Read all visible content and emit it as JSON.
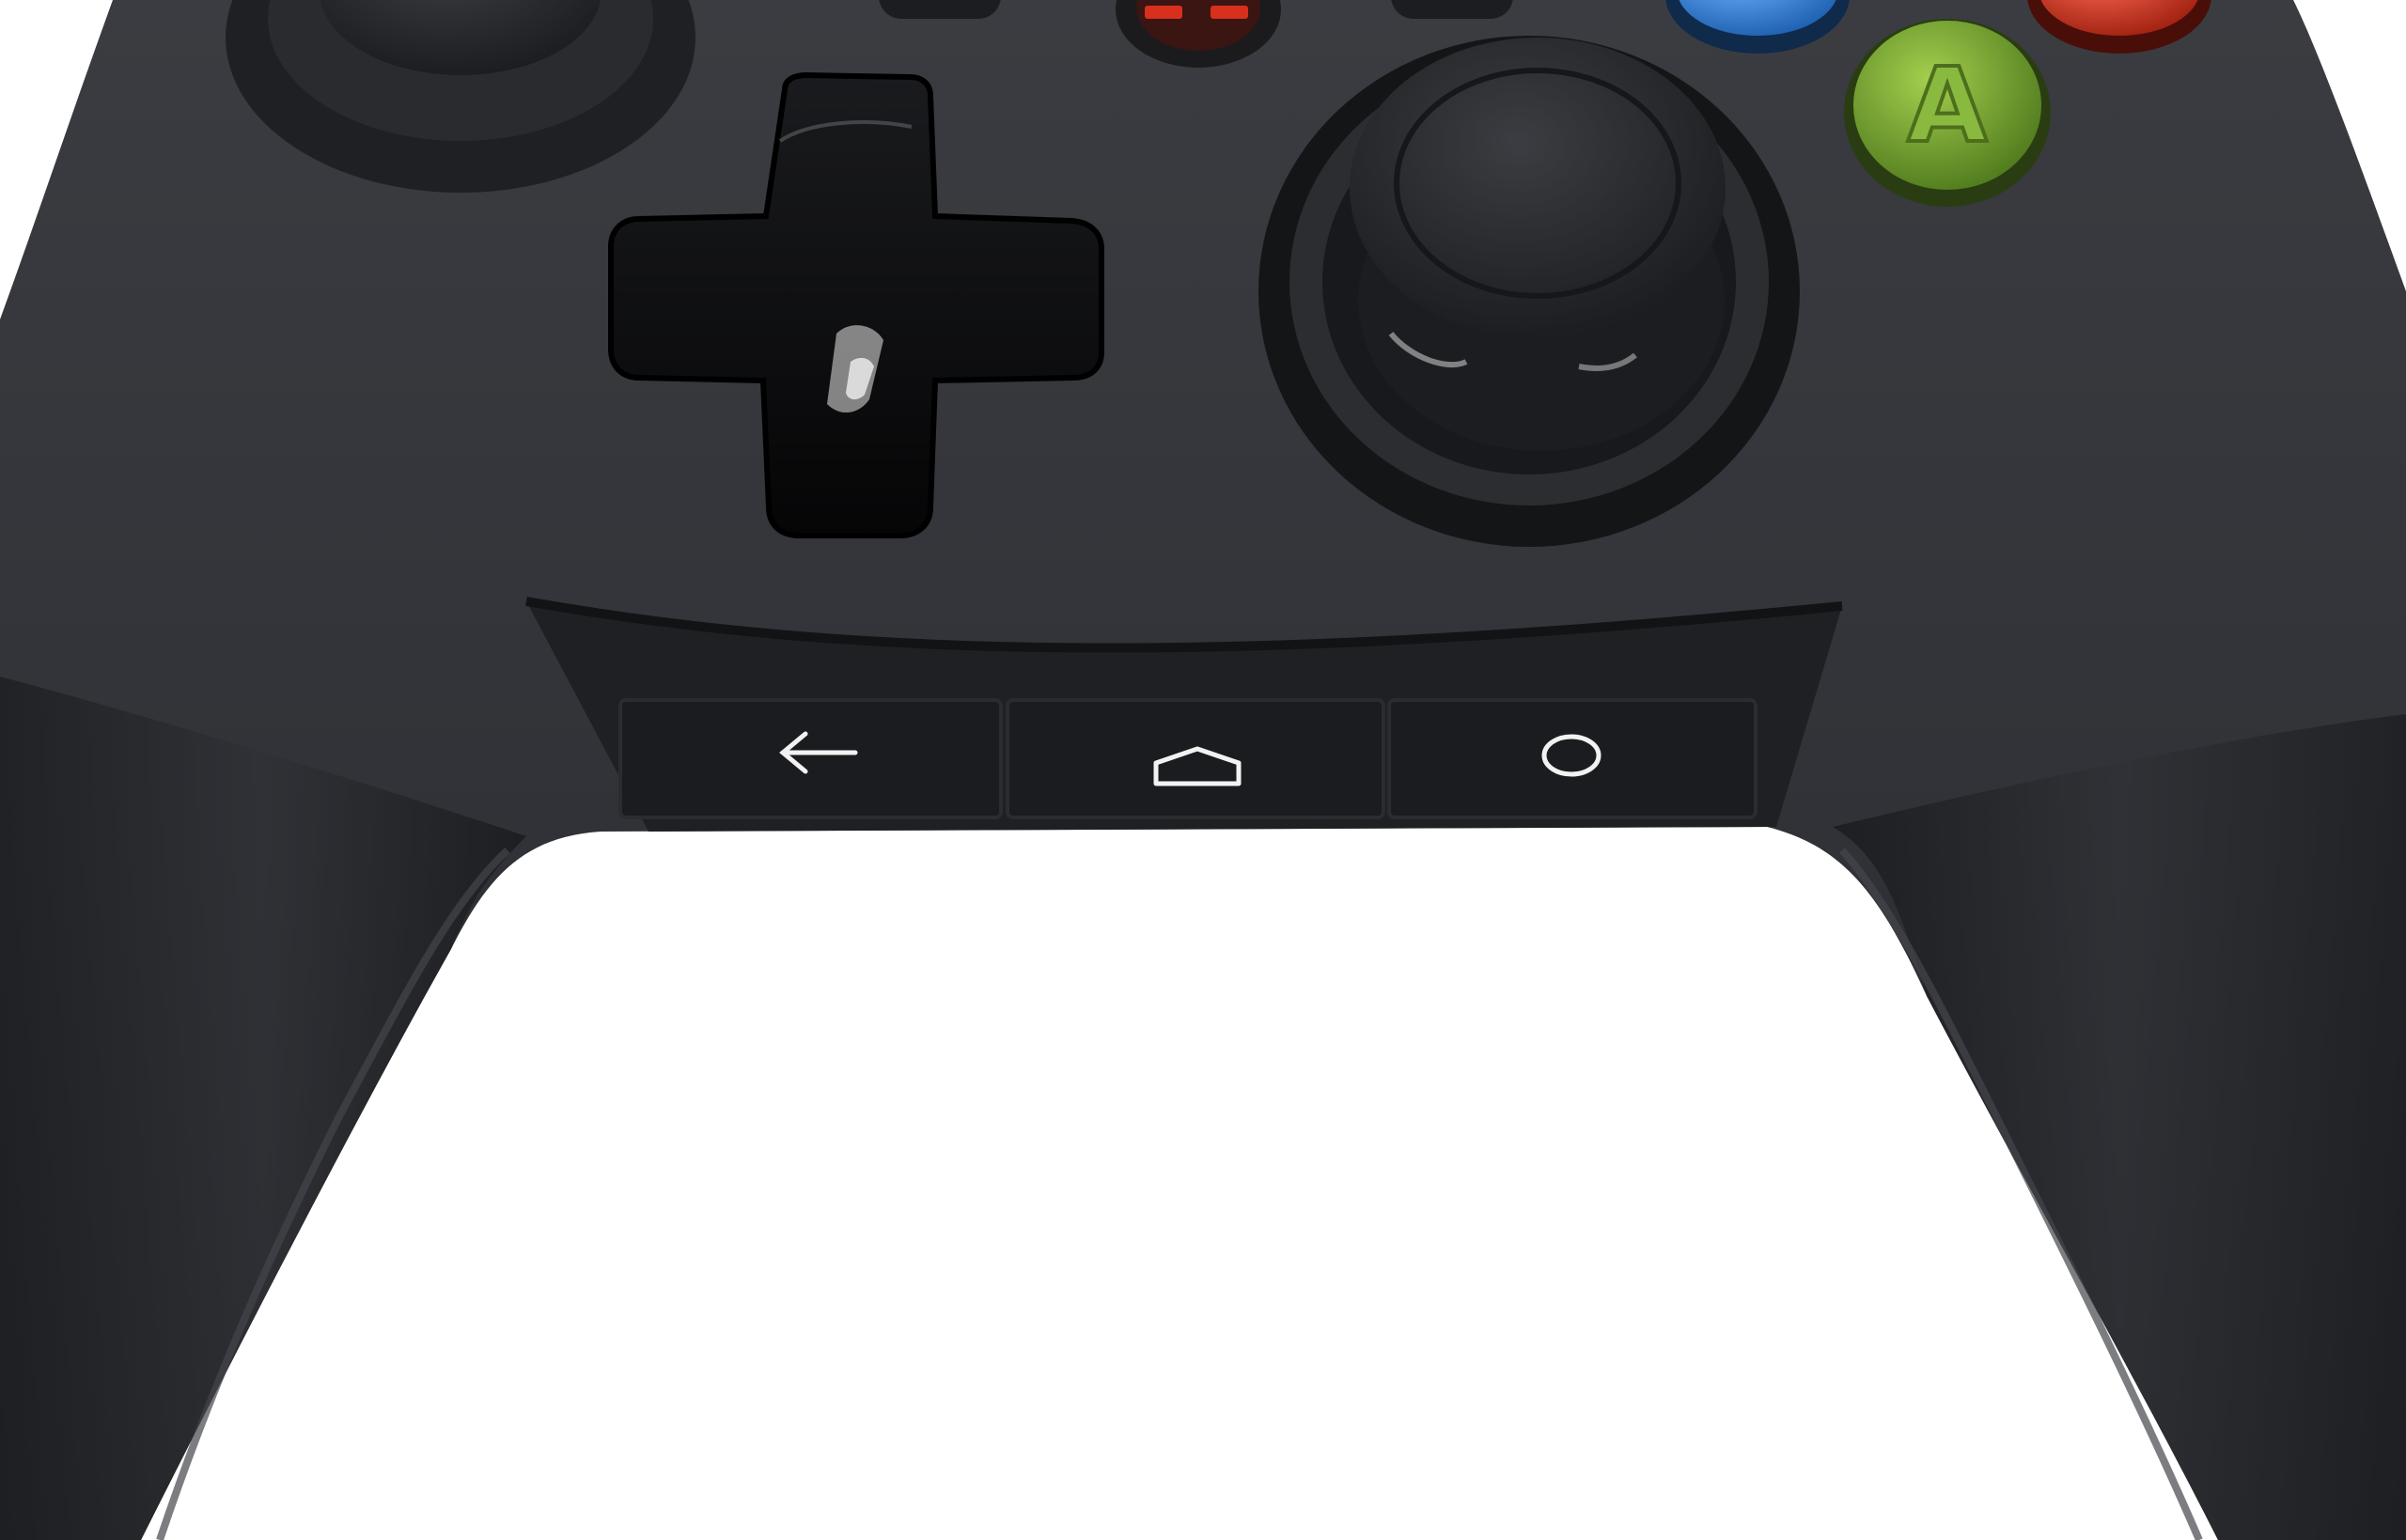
{
  "controller": {
    "colors": {
      "body": "#34363b",
      "body_shadow": "#1c1d20",
      "nav_panel": "#1e1f22",
      "dpad": "#0d0e10",
      "stick": "#1f2023",
      "button_blue": "#3e8fe0",
      "button_red": "#e0402f",
      "button_green": "#7aa532",
      "nav_glyph": "#f2f2f2"
    },
    "face_buttons": [
      {
        "name": "a-button",
        "letter": "A",
        "color": "#7aa532"
      },
      {
        "name": "x-button",
        "letter": "",
        "color": "#3e8fe0"
      },
      {
        "name": "b-button",
        "letter": "",
        "color": "#e0402f"
      }
    ],
    "nav_buttons": [
      {
        "name": "back-button",
        "icon": "back-arrow-icon"
      },
      {
        "name": "home-button",
        "icon": "home-icon"
      },
      {
        "name": "recents-button",
        "icon": "circle-icon"
      }
    ]
  }
}
